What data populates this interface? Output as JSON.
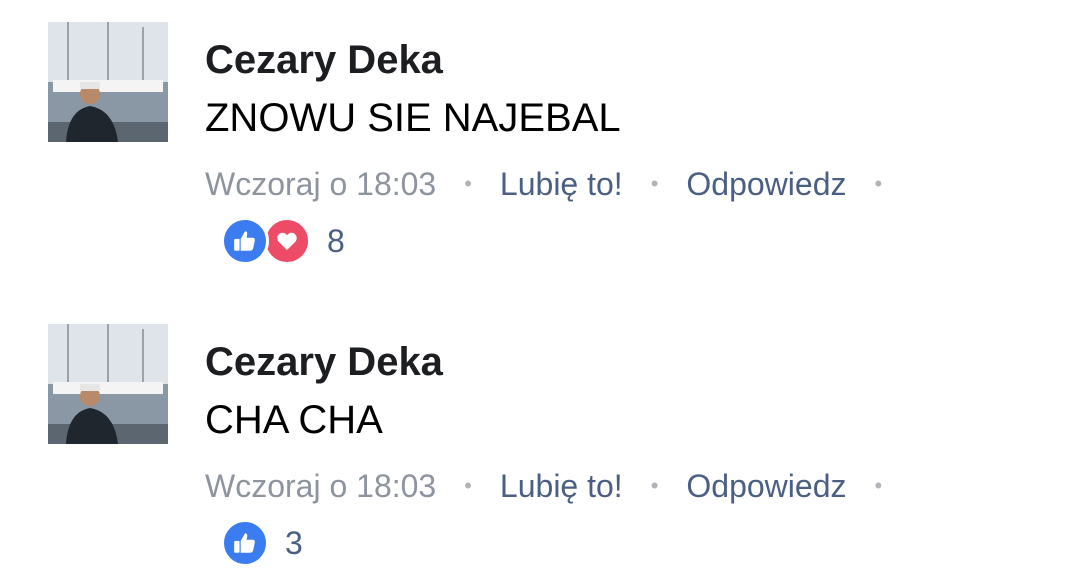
{
  "comments": [
    {
      "author": "Cezary Deka",
      "text": "ZNOWU SIE NAJEBAL",
      "time": "Wczoraj o 18:03",
      "like_label": "Lubię to!",
      "reply_label": "Odpowiedz",
      "reactions": [
        "like-icon",
        "heart-icon"
      ],
      "reaction_count": "8"
    },
    {
      "author": "Cezary Deka",
      "text": "CHA CHA",
      "time": "Wczoraj o 18:03",
      "like_label": "Lubię to!",
      "reply_label": "Odpowiedz",
      "reactions": [
        "like-icon"
      ],
      "reaction_count": "3"
    }
  ],
  "separator": "•",
  "colors": {
    "like": "#3b7cf0",
    "love": "#ee4b68",
    "link": "#4b5f84",
    "muted": "#8d949e"
  }
}
